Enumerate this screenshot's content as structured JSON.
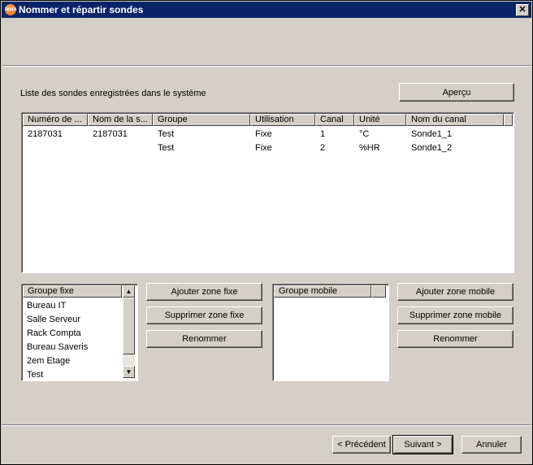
{
  "window": {
    "title": "Nommer et répartir sondes",
    "close_label": "✕"
  },
  "probes": {
    "label": "Liste des sondes enregistrées dans le système",
    "preview_button": "Aperçu",
    "columns": [
      "Numéro de ...",
      "Nom de la s...",
      "Groupe",
      "Utilisation",
      "Canal",
      "Unité",
      "Nom du canal"
    ],
    "rows": [
      [
        "2187031",
        "2187031",
        "Test",
        "Fixe",
        "1",
        "°C",
        "Sonde1_1"
      ],
      [
        "",
        "",
        "Test",
        "Fixe",
        "2",
        "%HR",
        "Sonde1_2"
      ]
    ]
  },
  "fixed_group": {
    "header": "Groupe fixe",
    "items": [
      "Bureau IT",
      "Salle Serveur",
      "Rack Compta",
      "Bureau Saveris",
      "2em Etage",
      "Test"
    ],
    "add_button": "Ajouter zone fixe",
    "remove_button": "Supprimer zone fixe",
    "rename_button": "Renommer"
  },
  "mobile_group": {
    "header": "Groupe mobile",
    "items": [],
    "add_button": "Ajouter zone mobile",
    "remove_button": "Supprimer zone mobile",
    "rename_button": "Renommer"
  },
  "footer": {
    "back_button": "< Précédent",
    "next_button": "Suivant >",
    "cancel_button": "Annuler"
  }
}
